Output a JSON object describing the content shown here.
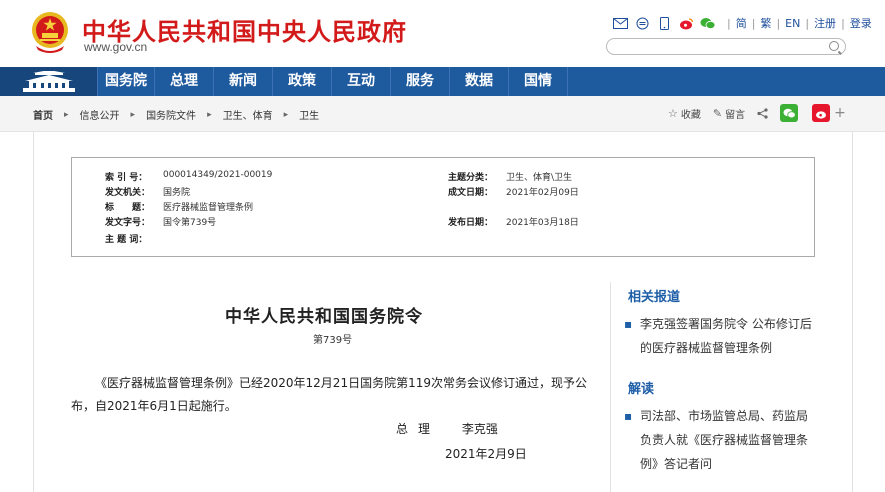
{
  "header": {
    "site_title": "中华人民共和国中央人民政府",
    "site_url": "www.gov.cn",
    "top_links": [
      "简",
      "繁",
      "EN",
      "注册",
      "登录"
    ],
    "search_placeholder": "",
    "icons": [
      "mail-icon",
      "message-icon",
      "mobile-icon",
      "weibo-icon",
      "wechat-icon"
    ]
  },
  "nav": {
    "items": [
      "国务院",
      "总理",
      "新闻",
      "政策",
      "互动",
      "服务",
      "数据",
      "国情"
    ]
  },
  "breadcrumb": {
    "items": [
      "首页",
      "信息公开",
      "国务院文件",
      "卫生、体育",
      "卫生"
    ]
  },
  "actions": {
    "favorite": "收藏",
    "comment": "留言"
  },
  "meta": {
    "index_label": "索 引 号：",
    "index_value": "000014349/2021-00019",
    "category_label": "主题分类：",
    "category_value": "卫生、体育\\卫生",
    "issuer_label": "发文机关：",
    "issuer_value": "国务院",
    "created_label": "成文日期：",
    "created_value": "2021年02月09日",
    "title_label": "标　　题：",
    "title_value": "医疗器械监督管理条例",
    "doc_no_label": "发文字号：",
    "doc_no_value": "国令第739号",
    "published_label": "发布日期：",
    "published_value": "2021年03月18日",
    "keywords_label": "主 题 词：",
    "keywords_value": ""
  },
  "article": {
    "title": "中华人民共和国国务院令",
    "subtitle": "第739号",
    "body": "《医疗器械监督管理条例》已经2020年12月21日国务院第119次常务会议修订通过，现予公布，自2021年6月1日起施行。",
    "signature_role": "总理",
    "signature_name": "李克强",
    "sign_date": "2021年2月9日"
  },
  "sidebar": {
    "related_heading": "相关报道",
    "related_items": [
      "李克强签署国务院令 公布修订后的医疗器械监督管理条例"
    ],
    "interpret_heading": "解读",
    "interpret_items": [
      "司法部、市场监管总局、药监局负责人就《医疗器械监督管理条例》答记者问"
    ]
  },
  "colors": {
    "brand_red": "#d31a1a",
    "nav_blue": "#1e5a9e",
    "link_blue": "#1f5fa8"
  }
}
